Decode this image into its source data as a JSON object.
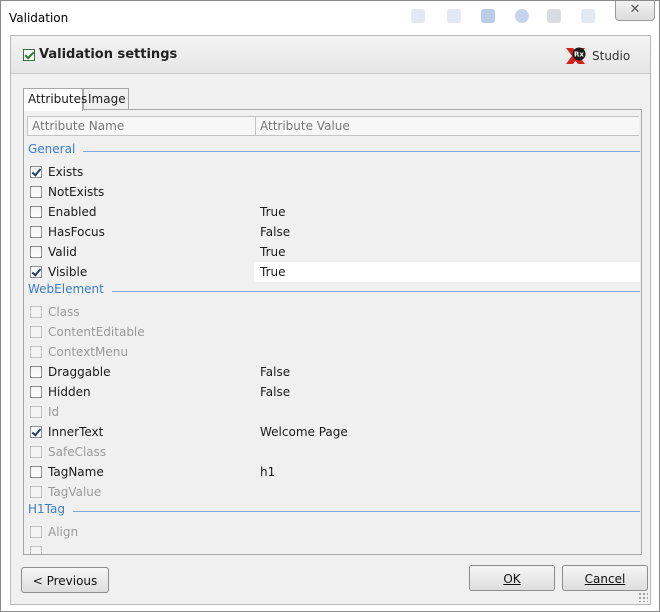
{
  "window": {
    "title": "Validation",
    "close_glyph": "✕"
  },
  "header": {
    "title": "Validation settings",
    "logo_text": "Studio",
    "logo_badge": "Rx"
  },
  "tabs": [
    {
      "label": "Attributes",
      "active": true
    },
    {
      "label": "Image",
      "active": false
    }
  ],
  "columns": {
    "name": "Attribute Name",
    "value": "Attribute Value"
  },
  "groups": [
    {
      "name": "General",
      "rows": [
        {
          "name": "Exists",
          "checked": true,
          "disabled": false,
          "value": ""
        },
        {
          "name": "NotExists",
          "checked": false,
          "disabled": false,
          "value": ""
        },
        {
          "name": "Enabled",
          "checked": false,
          "disabled": false,
          "value": "True"
        },
        {
          "name": "HasFocus",
          "checked": false,
          "disabled": false,
          "value": "False"
        },
        {
          "name": "Valid",
          "checked": false,
          "disabled": false,
          "value": "True"
        },
        {
          "name": "Visible",
          "checked": true,
          "disabled": false,
          "value": "True",
          "selected": true
        }
      ]
    },
    {
      "name": "WebElement",
      "rows": [
        {
          "name": "Class",
          "checked": false,
          "disabled": true,
          "value": ""
        },
        {
          "name": "ContentEditable",
          "checked": false,
          "disabled": true,
          "value": ""
        },
        {
          "name": "ContextMenu",
          "checked": false,
          "disabled": true,
          "value": ""
        },
        {
          "name": "Draggable",
          "checked": false,
          "disabled": false,
          "value": "False"
        },
        {
          "name": "Hidden",
          "checked": false,
          "disabled": false,
          "value": "False"
        },
        {
          "name": "Id",
          "checked": false,
          "disabled": true,
          "value": ""
        },
        {
          "name": "InnerText",
          "checked": true,
          "disabled": false,
          "value": "Welcome Page"
        },
        {
          "name": "SafeClass",
          "checked": false,
          "disabled": true,
          "value": ""
        },
        {
          "name": "TagName",
          "checked": false,
          "disabled": false,
          "value": "h1"
        },
        {
          "name": "TagValue",
          "checked": false,
          "disabled": true,
          "value": ""
        }
      ]
    },
    {
      "name": "H1Tag",
      "rows": [
        {
          "name": "Align",
          "checked": false,
          "disabled": true,
          "value": ""
        },
        {
          "name": "",
          "checked": false,
          "disabled": true,
          "value": ""
        }
      ]
    }
  ],
  "buttons": {
    "previous": "< Previous",
    "ok": "OK",
    "cancel": "Cancel"
  },
  "colors": {
    "group_header": "#3a7dc6",
    "client_bg": "#f0f0f0"
  }
}
